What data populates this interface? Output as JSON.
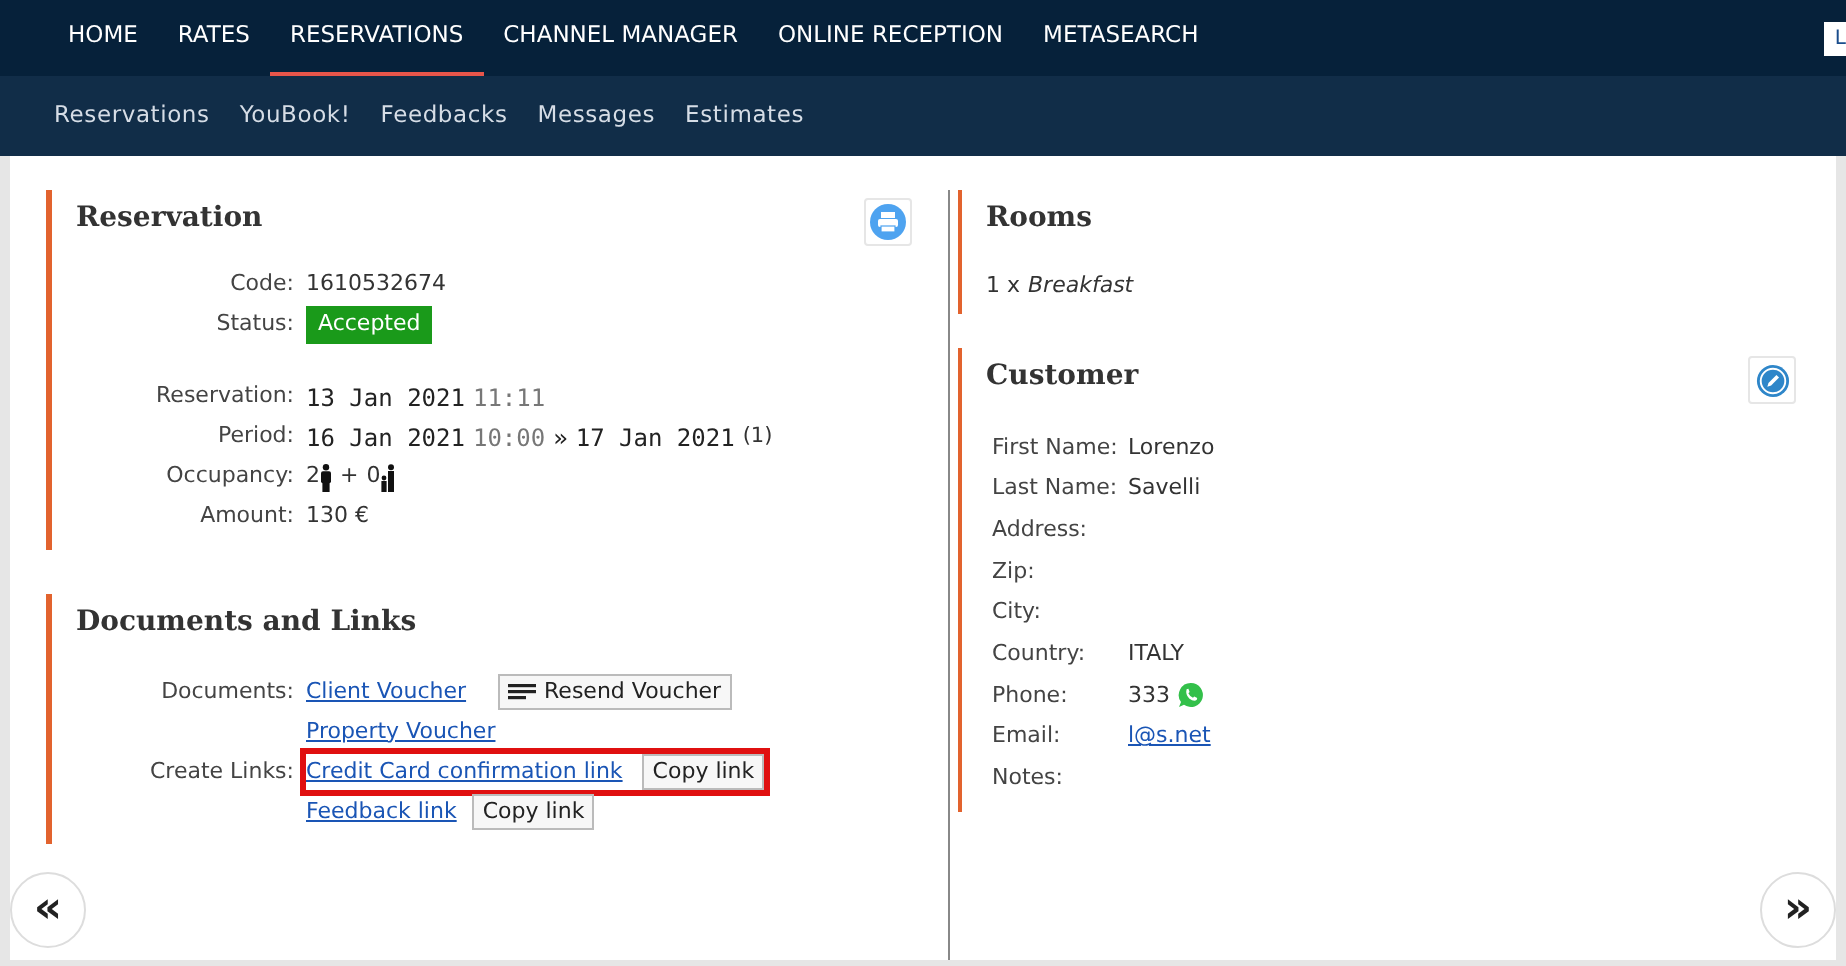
{
  "top_nav": [
    {
      "label": "HOME",
      "selected": false
    },
    {
      "label": "RATES",
      "selected": false
    },
    {
      "label": "RESERVATIONS",
      "selected": true
    },
    {
      "label": "CHANNEL MANAGER",
      "selected": false
    },
    {
      "label": "ONLINE RECEPTION",
      "selected": false
    },
    {
      "label": "METASEARCH",
      "selected": false
    }
  ],
  "user_badge": "L",
  "prev_arrow": "«",
  "next_arrow": "»",
  "sub_nav": [
    "Reservations",
    "YouBook!",
    "Feedbacks",
    "Messages",
    "Estimates"
  ],
  "reservation": {
    "title": "Reservation",
    "code_label": "Code:",
    "code": "1610532674",
    "status_label": "Status:",
    "status": "Accepted",
    "reservation_label": "Reservation:",
    "reservation_date": "13 Jan 2021",
    "reservation_time": "11:11",
    "period_label": "Period:",
    "period_from": "16 Jan 2021",
    "period_time": "10:00",
    "period_sep": "»",
    "period_to": "17 Jan 2021",
    "nights": "(1)",
    "occupancy_label": "Occupancy:",
    "adults": "2",
    "plus": "+",
    "children": "0",
    "amount_label": "Amount:",
    "amount": "130 €"
  },
  "documents": {
    "title": "Documents and Links",
    "documents_label": "Documents:",
    "client_voucher": "Client Voucher",
    "resend": "Resend Voucher",
    "property_voucher": "Property Voucher",
    "links_label": "Create Links:",
    "links": [
      {
        "label": "Credit Card confirmation link",
        "button": "Copy link",
        "highlighted": true
      },
      {
        "label": "Feedback link",
        "button": "Copy link",
        "highlighted": false
      }
    ]
  },
  "rooms": {
    "title": "Rooms",
    "count": "1 x",
    "name": "Breakfast"
  },
  "customer": {
    "title": "Customer",
    "fields": [
      {
        "label": "First Name:",
        "value": "Lorenzo",
        "kind": "text"
      },
      {
        "label": "Last Name:",
        "value": "Savelli",
        "kind": "text"
      },
      {
        "label": "Address:",
        "kind": "text"
      },
      {
        "label": "Zip:",
        "kind": "text"
      },
      {
        "label": "City:",
        "kind": "text"
      },
      {
        "label": "Country:",
        "value": "ITALY",
        "kind": "text"
      },
      {
        "label": "Phone:",
        "value": "333",
        "kind": "phone"
      },
      {
        "label": "Email:",
        "value": "l@s.net",
        "kind": "link"
      },
      {
        "label": "Notes:",
        "kind": "text"
      }
    ]
  }
}
